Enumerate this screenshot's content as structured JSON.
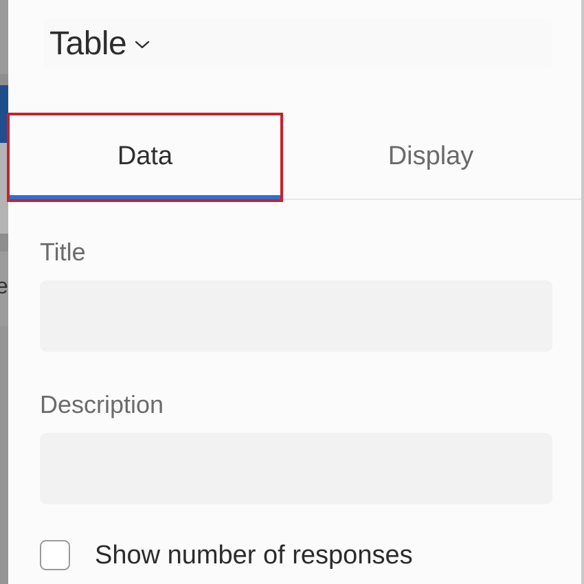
{
  "visualization": {
    "type_label": "Table"
  },
  "tabs": [
    {
      "label": "Data",
      "active": true
    },
    {
      "label": "Display",
      "active": false
    }
  ],
  "form": {
    "title_label": "Title",
    "title_value": "",
    "description_label": "Description",
    "description_value": "",
    "show_responses_label": "Show number of responses",
    "show_responses_checked": false
  },
  "colors": {
    "active_tab_underline": "#2f6fcf",
    "highlight_border": "#c8202c",
    "background_accent_blue": "#1f4e8c"
  },
  "background": {
    "partial_glyph": "e"
  },
  "icons": {
    "type_dropdown": "chevron-down-icon"
  }
}
